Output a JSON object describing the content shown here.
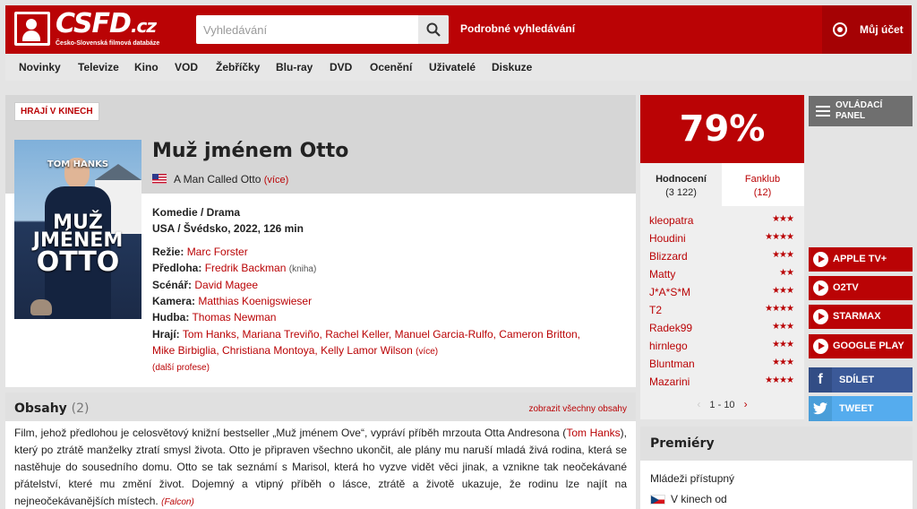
{
  "header": {
    "logo_text": "CSFD",
    "logo_tld": ".cz",
    "logo_subtitle": "Česko-Slovenská filmová databáze",
    "search_placeholder": "Vyhledávání",
    "advanced_search": "Podrobné vyhledávání",
    "account": "Můj účet"
  },
  "nav": {
    "items": [
      "Novinky",
      "Televize",
      "Kino",
      "VOD",
      "Žebříčky",
      "Blu-ray",
      "DVD",
      "Ocenění",
      "Uživatelé",
      "Diskuze"
    ]
  },
  "film": {
    "badge": "HRAJÍ V KINECH",
    "title": "Muž jménem Otto",
    "original_title": "A Man Called Otto",
    "original_more": "(více)",
    "genres": "Komedie / Drama",
    "origin": "USA / Švédsko, 2022, 126 min",
    "poster": {
      "actor": "TOM HANKS",
      "title_line1": "MUŽ",
      "title_line2": "JMÉNEM",
      "title_line3": "OTTO"
    },
    "credits": {
      "director_label": "Režie:",
      "director": "Marc Forster",
      "source_label": "Předloha:",
      "source": "Fredrik Backman",
      "source_note": "(kniha)",
      "screenplay_label": "Scénář:",
      "screenplay": "David Magee",
      "camera_label": "Kamera:",
      "camera": "Matthias Koenigswieser",
      "music_label": "Hudba:",
      "music": "Thomas Newman",
      "cast_label": "Hrají:",
      "cast_line1": "Tom Hanks, Mariana Treviño, Rachel Keller, Manuel Garcia-Rulfo, Cameron Britton,",
      "cast_line2": "Mike Birbiglia, Christiana Montoya, Kelly Lamor Wilson",
      "cast_more": "(více)",
      "more_professions": "(další profese)"
    }
  },
  "plots": {
    "title": "Obsahy",
    "count": "(2)",
    "show_all": "zobrazit všechny obsahy",
    "text_part1": "Film, jehož předlohou je celosvětový knižní bestseller „Muž jménem Ove“, vypráví příběh mrzouta Otta Andresona (",
    "text_link": "Tom Hanks",
    "text_part2": "), který po ztrátě manželky ztratí smysl života. Otto je připraven všechno ukončit, ale plány mu naruší mladá živá rodina, která se nastěhuje do sousedního domu. Otto se tak seznámí s Marisol, která ho vyzve vidět věci jinak, a vznikne tak neočekávané přátelství, které mu změní život. Dojemný a vtipný příběh o lásce, ztrátě a životě ukazuje, že rodinu lze najít na nejneočekávanějších místech.",
    "author": "(Falcon)"
  },
  "rating": {
    "percent": "79%",
    "tab_ratings": "Hodnocení",
    "tab_ratings_count": "(3 122)",
    "tab_fanclub": "Fanklub",
    "tab_fanclub_count": "(12)",
    "users": [
      {
        "name": "kleopatra",
        "stars": "★★★"
      },
      {
        "name": "Houdini",
        "stars": "★★★★"
      },
      {
        "name": "Blizzard",
        "stars": "★★★"
      },
      {
        "name": "Matty",
        "stars": "★★"
      },
      {
        "name": "J*A*S*M",
        "stars": "★★★"
      },
      {
        "name": "T2",
        "stars": "★★★★"
      },
      {
        "name": "Radek99",
        "stars": "★★★"
      },
      {
        "name": "hirnlego",
        "stars": "★★★"
      },
      {
        "name": "Bluntman",
        "stars": "★★★"
      },
      {
        "name": "Mazarini",
        "stars": "★★★★"
      }
    ],
    "pager": "1 - 10"
  },
  "sidebar": {
    "control_panel_line1": "OVLÁDACÍ",
    "control_panel_line2": "PANEL",
    "vod": [
      "APPLE TV+",
      "O2TV",
      "STARMAX",
      "GOOGLE PLAY"
    ],
    "share_fb": "SDÍLET",
    "share_tw": "TWEET"
  },
  "premieres": {
    "title": "Premiéry",
    "age": "Mládeži přístupný",
    "cinema": "V kinech od"
  },
  "colors": {
    "brand": "#ba0305",
    "facebook": "#3b5998",
    "twitter": "#55acee"
  }
}
